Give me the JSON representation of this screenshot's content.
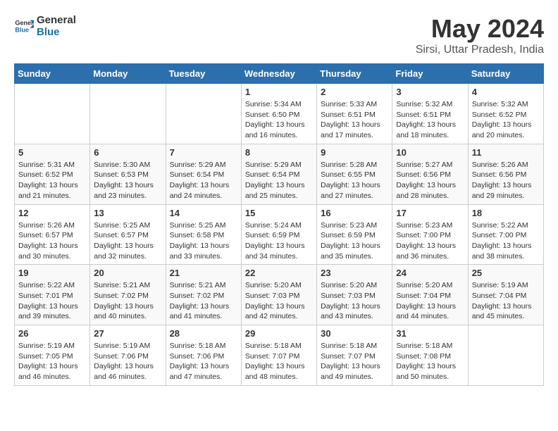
{
  "logo": {
    "line1": "General",
    "line2": "Blue"
  },
  "title": "May 2024",
  "subtitle": "Sirsi, Uttar Pradesh, India",
  "days_header": [
    "Sunday",
    "Monday",
    "Tuesday",
    "Wednesday",
    "Thursday",
    "Friday",
    "Saturday"
  ],
  "weeks": [
    [
      {
        "day": "",
        "info": ""
      },
      {
        "day": "",
        "info": ""
      },
      {
        "day": "",
        "info": ""
      },
      {
        "day": "1",
        "info": "Sunrise: 5:34 AM\nSunset: 6:50 PM\nDaylight: 13 hours\nand 16 minutes."
      },
      {
        "day": "2",
        "info": "Sunrise: 5:33 AM\nSunset: 6:51 PM\nDaylight: 13 hours\nand 17 minutes."
      },
      {
        "day": "3",
        "info": "Sunrise: 5:32 AM\nSunset: 6:51 PM\nDaylight: 13 hours\nand 18 minutes."
      },
      {
        "day": "4",
        "info": "Sunrise: 5:32 AM\nSunset: 6:52 PM\nDaylight: 13 hours\nand 20 minutes."
      }
    ],
    [
      {
        "day": "5",
        "info": "Sunrise: 5:31 AM\nSunset: 6:52 PM\nDaylight: 13 hours\nand 21 minutes."
      },
      {
        "day": "6",
        "info": "Sunrise: 5:30 AM\nSunset: 6:53 PM\nDaylight: 13 hours\nand 23 minutes."
      },
      {
        "day": "7",
        "info": "Sunrise: 5:29 AM\nSunset: 6:54 PM\nDaylight: 13 hours\nand 24 minutes."
      },
      {
        "day": "8",
        "info": "Sunrise: 5:29 AM\nSunset: 6:54 PM\nDaylight: 13 hours\nand 25 minutes."
      },
      {
        "day": "9",
        "info": "Sunrise: 5:28 AM\nSunset: 6:55 PM\nDaylight: 13 hours\nand 27 minutes."
      },
      {
        "day": "10",
        "info": "Sunrise: 5:27 AM\nSunset: 6:56 PM\nDaylight: 13 hours\nand 28 minutes."
      },
      {
        "day": "11",
        "info": "Sunrise: 5:26 AM\nSunset: 6:56 PM\nDaylight: 13 hours\nand 29 minutes."
      }
    ],
    [
      {
        "day": "12",
        "info": "Sunrise: 5:26 AM\nSunset: 6:57 PM\nDaylight: 13 hours\nand 30 minutes."
      },
      {
        "day": "13",
        "info": "Sunrise: 5:25 AM\nSunset: 6:57 PM\nDaylight: 13 hours\nand 32 minutes."
      },
      {
        "day": "14",
        "info": "Sunrise: 5:25 AM\nSunset: 6:58 PM\nDaylight: 13 hours\nand 33 minutes."
      },
      {
        "day": "15",
        "info": "Sunrise: 5:24 AM\nSunset: 6:59 PM\nDaylight: 13 hours\nand 34 minutes."
      },
      {
        "day": "16",
        "info": "Sunrise: 5:23 AM\nSunset: 6:59 PM\nDaylight: 13 hours\nand 35 minutes."
      },
      {
        "day": "17",
        "info": "Sunrise: 5:23 AM\nSunset: 7:00 PM\nDaylight: 13 hours\nand 36 minutes."
      },
      {
        "day": "18",
        "info": "Sunrise: 5:22 AM\nSunset: 7:00 PM\nDaylight: 13 hours\nand 38 minutes."
      }
    ],
    [
      {
        "day": "19",
        "info": "Sunrise: 5:22 AM\nSunset: 7:01 PM\nDaylight: 13 hours\nand 39 minutes."
      },
      {
        "day": "20",
        "info": "Sunrise: 5:21 AM\nSunset: 7:02 PM\nDaylight: 13 hours\nand 40 minutes."
      },
      {
        "day": "21",
        "info": "Sunrise: 5:21 AM\nSunset: 7:02 PM\nDaylight: 13 hours\nand 41 minutes."
      },
      {
        "day": "22",
        "info": "Sunrise: 5:20 AM\nSunset: 7:03 PM\nDaylight: 13 hours\nand 42 minutes."
      },
      {
        "day": "23",
        "info": "Sunrise: 5:20 AM\nSunset: 7:03 PM\nDaylight: 13 hours\nand 43 minutes."
      },
      {
        "day": "24",
        "info": "Sunrise: 5:20 AM\nSunset: 7:04 PM\nDaylight: 13 hours\nand 44 minutes."
      },
      {
        "day": "25",
        "info": "Sunrise: 5:19 AM\nSunset: 7:04 PM\nDaylight: 13 hours\nand 45 minutes."
      }
    ],
    [
      {
        "day": "26",
        "info": "Sunrise: 5:19 AM\nSunset: 7:05 PM\nDaylight: 13 hours\nand 46 minutes."
      },
      {
        "day": "27",
        "info": "Sunrise: 5:19 AM\nSunset: 7:06 PM\nDaylight: 13 hours\nand 46 minutes."
      },
      {
        "day": "28",
        "info": "Sunrise: 5:18 AM\nSunset: 7:06 PM\nDaylight: 13 hours\nand 47 minutes."
      },
      {
        "day": "29",
        "info": "Sunrise: 5:18 AM\nSunset: 7:07 PM\nDaylight: 13 hours\nand 48 minutes."
      },
      {
        "day": "30",
        "info": "Sunrise: 5:18 AM\nSunset: 7:07 PM\nDaylight: 13 hours\nand 49 minutes."
      },
      {
        "day": "31",
        "info": "Sunrise: 5:18 AM\nSunset: 7:08 PM\nDaylight: 13 hours\nand 50 minutes."
      },
      {
        "day": "",
        "info": ""
      }
    ]
  ]
}
